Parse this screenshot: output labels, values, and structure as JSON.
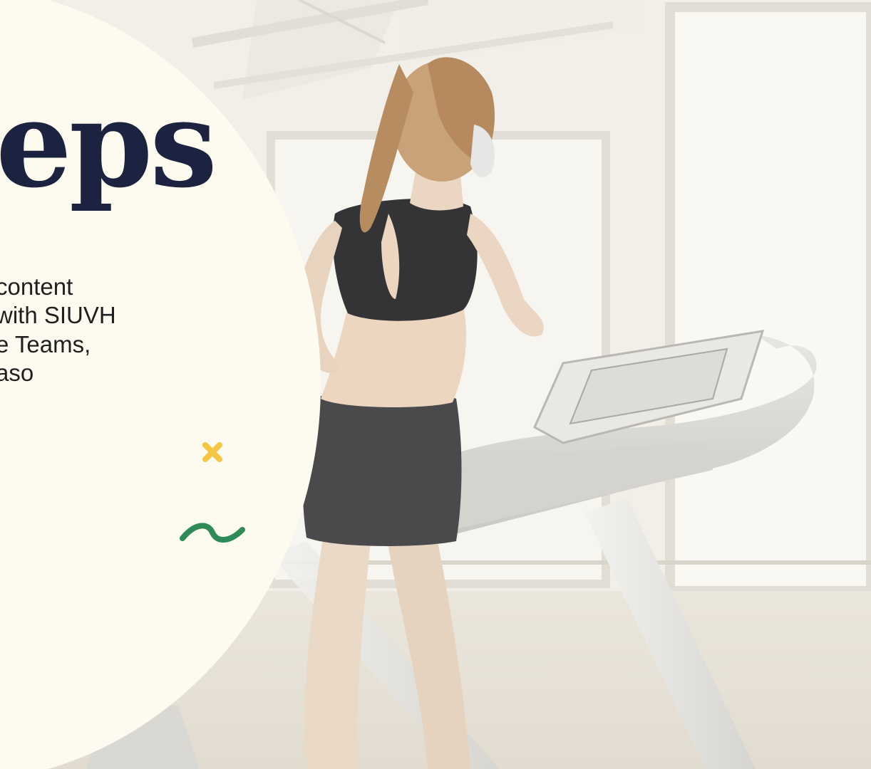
{
  "slide": {
    "headline": "eps",
    "body_lines": [
      "content",
      "with SIUVH",
      "e Teams,",
      "aso"
    ]
  },
  "decorations": {
    "cross_icon": "close-icon",
    "wave_icon": "wave-icon"
  },
  "colors": {
    "panel": "#fdfbf0",
    "headline": "#1c2340",
    "cross": "#f3c744",
    "wave": "#2e8b57"
  },
  "photo": {
    "subject": "woman-running-on-treadmill"
  }
}
